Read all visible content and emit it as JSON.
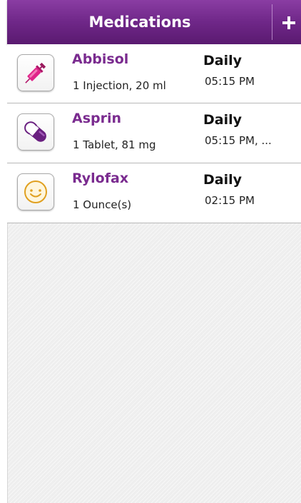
{
  "header": {
    "title": "Medications",
    "add_icon": "plus-icon",
    "background_color": "#6f2788"
  },
  "medications": [
    {
      "name": "Abbisol",
      "dose": "1 Injection, 20 ml",
      "frequency": "Daily",
      "time": "05:15 PM",
      "icon": "syringe-icon"
    },
    {
      "name": "Asprin",
      "dose": "1 Tablet, 81 mg",
      "frequency": "Daily",
      "time": "05:15 PM, ...",
      "icon": "capsule-icon"
    },
    {
      "name": "Rylofax",
      "dose": "1 Ounce(s)",
      "frequency": "Daily",
      "time": "02:15 PM",
      "icon": "smiley-icon"
    }
  ],
  "colors": {
    "accent": "#7a2b8f",
    "syringe": "#d81b7e",
    "capsule": "#6a2080",
    "smiley": "#e0a020"
  }
}
